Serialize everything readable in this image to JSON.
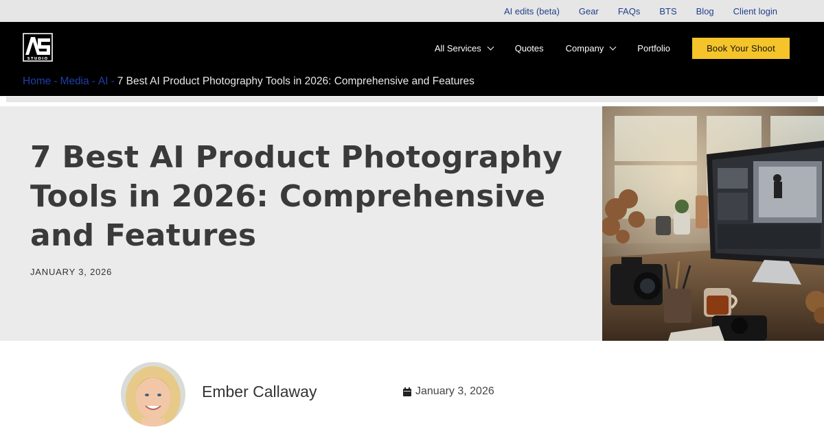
{
  "topbar": {
    "links": [
      "AI edits (beta)",
      "Gear",
      "FAQs",
      "BTS",
      "Blog",
      "Client login"
    ]
  },
  "header": {
    "logo_icon": "studio-logo-icon",
    "logo_text": "STUDIO",
    "nav": [
      {
        "label": "All Services",
        "dropdown": true
      },
      {
        "label": "Quotes",
        "dropdown": false
      },
      {
        "label": "Company",
        "dropdown": true
      },
      {
        "label": "Portfolio",
        "dropdown": false
      }
    ],
    "cta_label": "Book Your Shoot",
    "cta_color": "#f4c42a"
  },
  "breadcrumb": {
    "items": [
      "Home",
      "Media",
      "AI"
    ],
    "separator": "-",
    "current": "7 Best AI Product Photography Tools in 2026: Comprehensive and Features"
  },
  "hero": {
    "title": "7 Best AI Product Photography Tools in 2026: Comprehensive and Features",
    "date": "JANUARY 3, 2026"
  },
  "author": {
    "name": "Ember Callaway",
    "date": "January 3, 2026",
    "date_icon": "calendar-icon"
  },
  "colors": {
    "header_bg": "#000000",
    "link_blue": "#1e3fa8",
    "hero_bg": "#ebebeb"
  }
}
